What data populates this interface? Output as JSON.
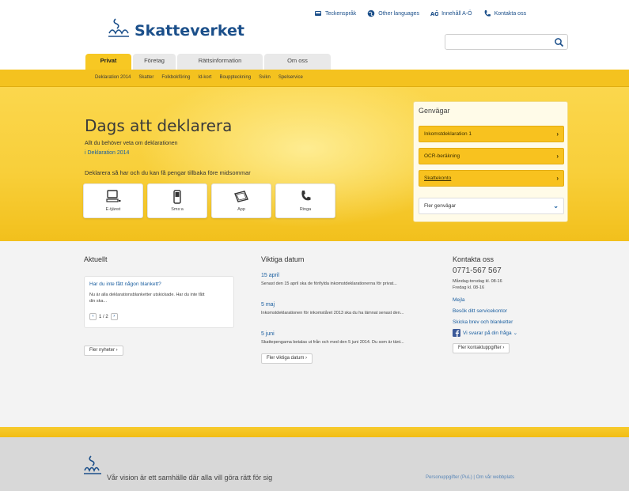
{
  "brand": {
    "name": "Skatteverket"
  },
  "utilities": [
    {
      "label": "Teckenspråk",
      "icon": "sign-language-icon"
    },
    {
      "label": "Other languages",
      "icon": "globe-icon"
    },
    {
      "label": "Innehåll A-Ö",
      "icon": "a-z-index-icon"
    },
    {
      "label": "Kontakta oss",
      "icon": "phone-icon"
    }
  ],
  "search": {
    "placeholder": "",
    "icon": "search-icon"
  },
  "tabs": [
    {
      "label": "Privat",
      "active": true
    },
    {
      "label": "Företag",
      "active": false
    },
    {
      "label": "Rättsinformation",
      "active": false
    },
    {
      "label": "Om oss",
      "active": false
    }
  ],
  "subnav": [
    "Deklaration 2014",
    "Skatter",
    "Folkbokföring",
    "Id-kort",
    "Bouppteckning",
    "Svikn",
    "Spelservice"
  ],
  "hero": {
    "title": "Dags att deklarera",
    "subtitle": "Allt du behöver veta om deklarationen",
    "link": "i Deklaration 2014",
    "tagline": "Deklarera så har och du kan få pengar tillbaka före midsommar",
    "tiles": [
      {
        "label": "E-tjänst",
        "icon": "computer-icon"
      },
      {
        "label": "Sms:a",
        "icon": "mobile-phone-icon"
      },
      {
        "label": "App",
        "icon": "tablet-icon"
      },
      {
        "label": "Ringa",
        "icon": "phone-icon"
      }
    ]
  },
  "genvagar": {
    "title": "Genvägar",
    "items": [
      {
        "label": "Inkomstdeklaration 1"
      },
      {
        "label": "OCR-beräkning"
      },
      {
        "label": "Skattekonto"
      },
      {
        "label": "Fler genvägar"
      }
    ]
  },
  "aktuellt": {
    "title": "Aktuellt",
    "headline": "Har du inte fått någon blankett?",
    "body": "Nu är alla deklarationsblanketter utskickade. Har du inte fått din ska...",
    "pager": "1 / 2",
    "more": "Fler nyheter"
  },
  "viktiga": {
    "title": "Viktiga datum",
    "items": [
      {
        "date": "15 april",
        "text": "Senast den 15 april ska de förifylda inkomstdeklarationerna för privat..."
      },
      {
        "date": "5 maj",
        "text": "Inkomstdeklarationen för inkomståret 2013 ska du ha lämnat senast den..."
      },
      {
        "date": "5 juni",
        "text": "Skattepengarna betalas ut från och med den 5 juni 2014. Du som är tänt..."
      }
    ],
    "more": "Fler viktiga datum"
  },
  "kontakt": {
    "title": "Kontakta oss",
    "phone": "0771-567 567",
    "hours1": "Måndag-torsdag kl. 08-16",
    "hours2": "Fredag kl. 08-16",
    "links": [
      "Mejla",
      "Besök ditt servicekontor",
      "Skicka brev och blanketter"
    ],
    "facebook": "Vi svarar på din fråga",
    "more": "Fler kontaktuppgifter"
  },
  "footer": {
    "vision": "Vår vision är ett samhälle där alla vill göra rätt för sig",
    "links": "Personuppgifter (PuL) | Om vår webbplats"
  },
  "colors": {
    "accent": "#f4c21f",
    "brand_blue": "#1b4f8a",
    "link": "#1b5fa0"
  }
}
